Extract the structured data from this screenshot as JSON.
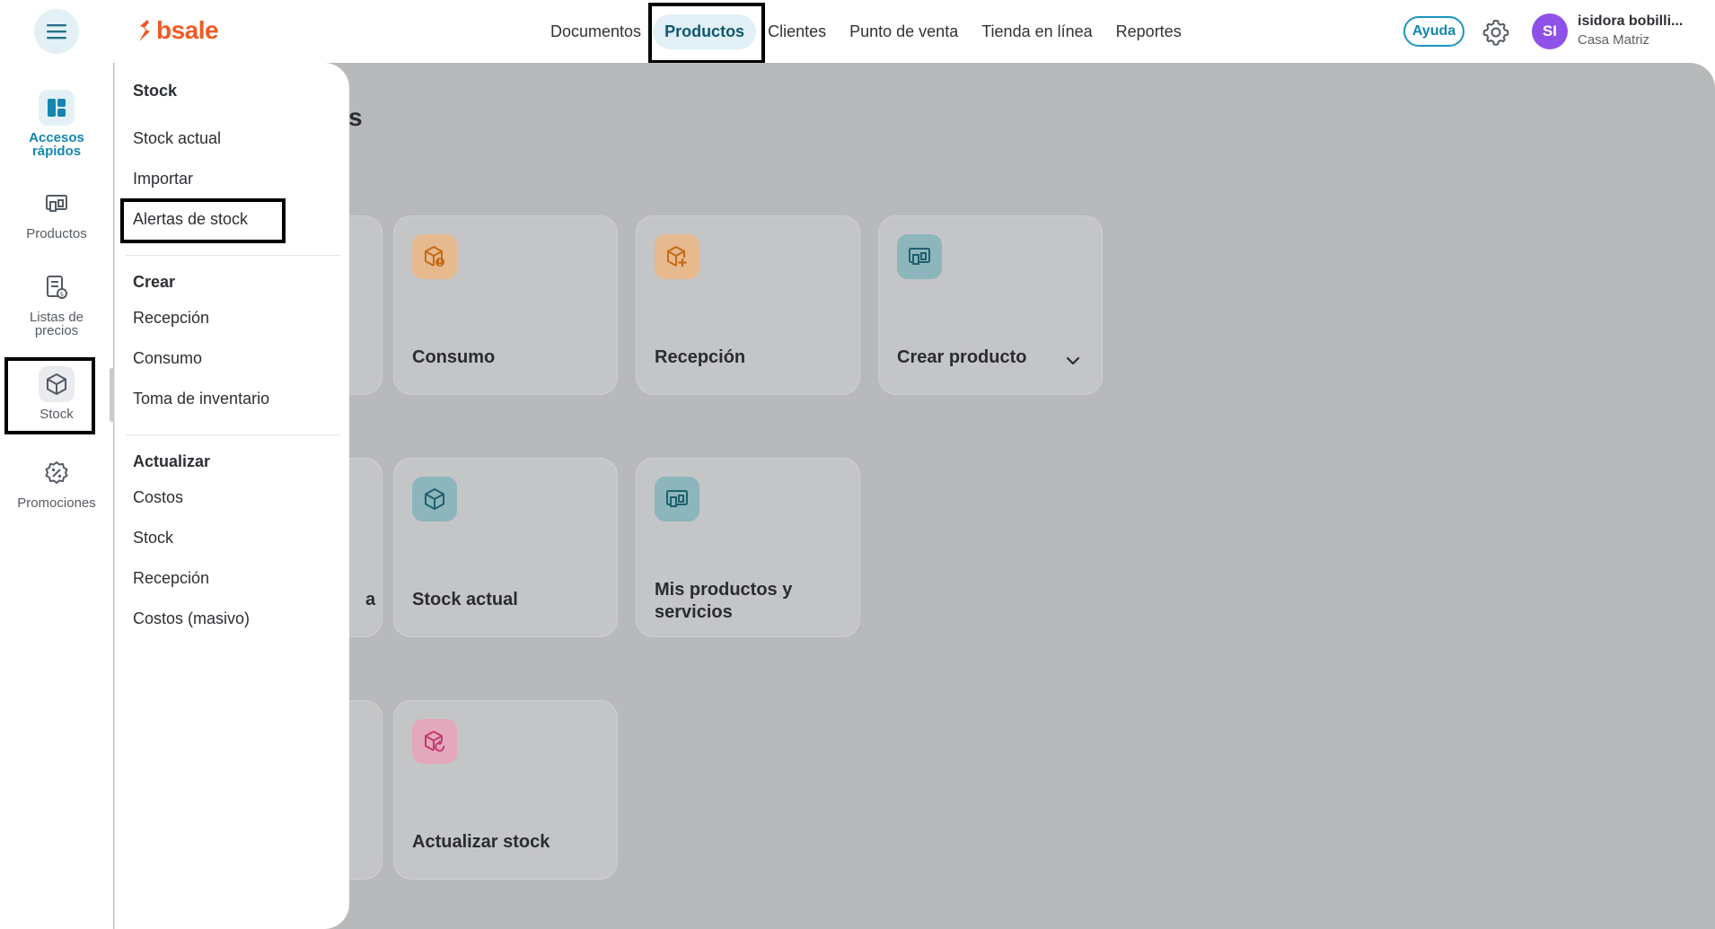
{
  "brand": {
    "logo_text": "bsale",
    "color": "#ef5b25"
  },
  "nav": {
    "items": [
      {
        "label": "Documentos",
        "active": false
      },
      {
        "label": "Productos",
        "active": true
      },
      {
        "label": "Clientes",
        "active": false
      },
      {
        "label": "Punto de venta",
        "active": false
      },
      {
        "label": "Tienda en línea",
        "active": false
      },
      {
        "label": "Reportes",
        "active": false
      }
    ]
  },
  "header": {
    "help_label": "Ayuda",
    "user_initials": "SI",
    "user_name": "isidora bobilli...",
    "user_branch": "Casa Matriz"
  },
  "sidebar": {
    "items": [
      {
        "label": "Accesos rápidos",
        "icon": "dashboard-icon",
        "state": "active"
      },
      {
        "label": "Productos",
        "icon": "products-icon",
        "state": "normal"
      },
      {
        "label": "Listas de precios",
        "icon": "price-list-icon",
        "state": "normal"
      },
      {
        "label": "Stock",
        "icon": "box-icon",
        "state": "selected"
      },
      {
        "label": "Promociones",
        "icon": "promotion-icon",
        "state": "normal"
      }
    ]
  },
  "main": {
    "title_fragment": "s",
    "cards": [
      {
        "label": "Consumo",
        "icon": "box-alert-icon",
        "icon_color": "#e6b98f"
      },
      {
        "label": "Recepción",
        "icon": "box-plus-icon",
        "icon_color": "#e6b98f"
      },
      {
        "label": "Crear producto",
        "icon": "products-icon",
        "icon_color": "#8cb6bb",
        "has_dropdown": true
      },
      {
        "label": "Stock actual",
        "icon": "box-icon",
        "icon_color": "#8cb6bb"
      },
      {
        "label": "Mis productos y servicios",
        "icon": "products-icon",
        "icon_color": "#8cb6bb"
      },
      {
        "label": "Actualizar stock",
        "icon": "box-refresh-icon",
        "icon_color": "#e4a8bd"
      }
    ],
    "partial_card_text": "a"
  },
  "stock_menu": {
    "sections": [
      {
        "heading": "Stock",
        "items": [
          "Stock actual",
          "Importar",
          "Alertas de stock"
        ]
      },
      {
        "heading": "Crear",
        "items": [
          "Recepción",
          "Consumo",
          "Toma de inventario"
        ]
      },
      {
        "heading": "Actualizar",
        "items": [
          "Costos",
          "Stock",
          "Recepción",
          "Costos (masivo)"
        ]
      }
    ]
  }
}
